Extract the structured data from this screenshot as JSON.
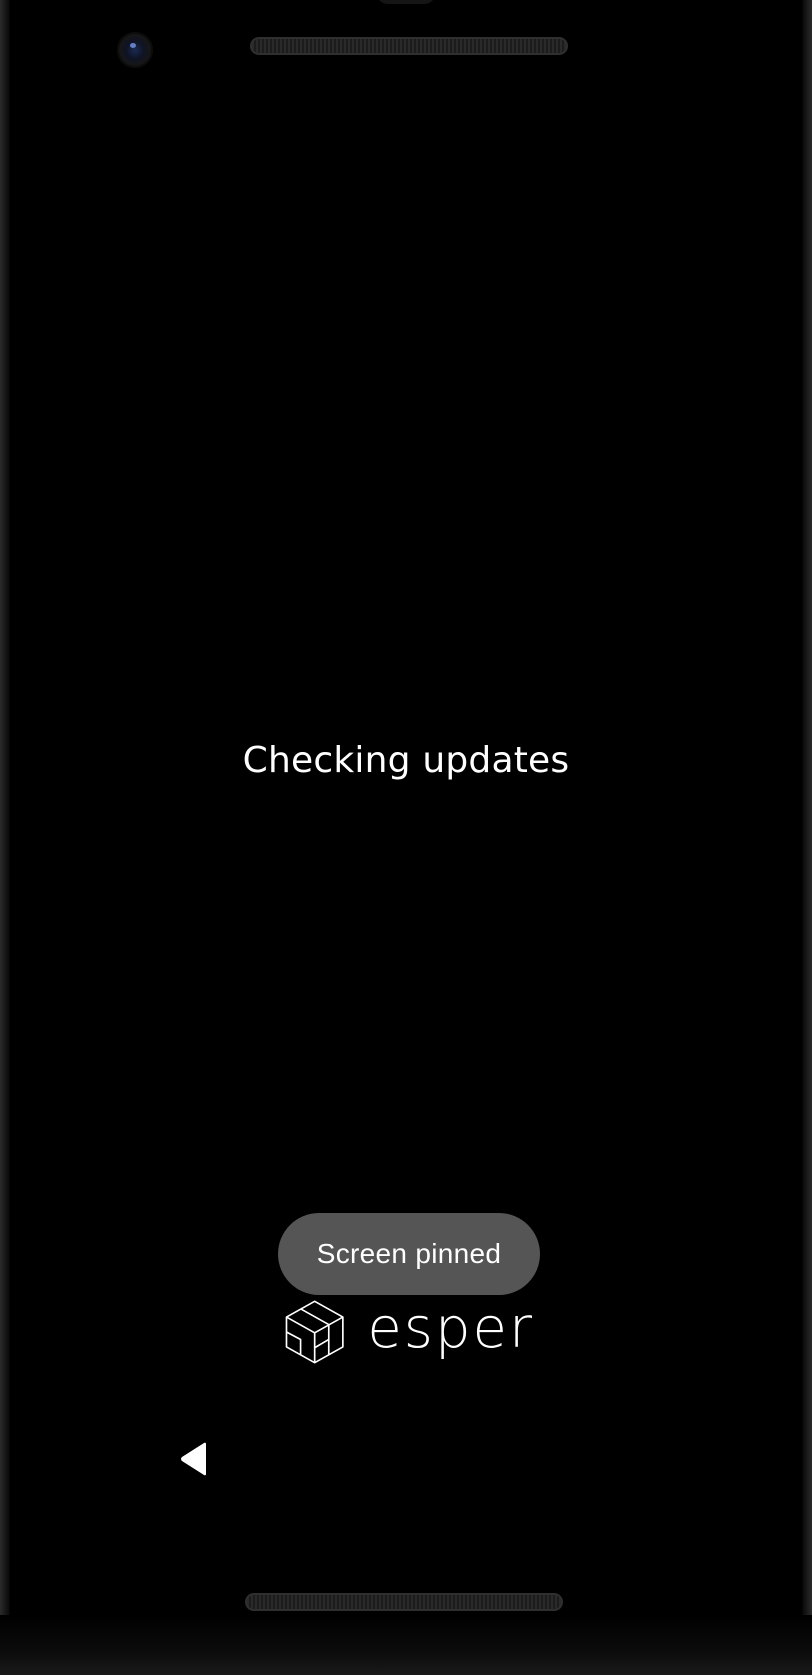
{
  "screen": {
    "status_message": "Checking updates"
  },
  "toast": {
    "message": "Screen pinned"
  },
  "brand": {
    "name": "esper",
    "logo_icon": "esper-cube-logo-icon"
  },
  "navigation": {
    "back_icon": "back-triangle-icon"
  },
  "colors": {
    "background": "#000000",
    "text": "#ffffff",
    "toast_background": "#555555"
  }
}
